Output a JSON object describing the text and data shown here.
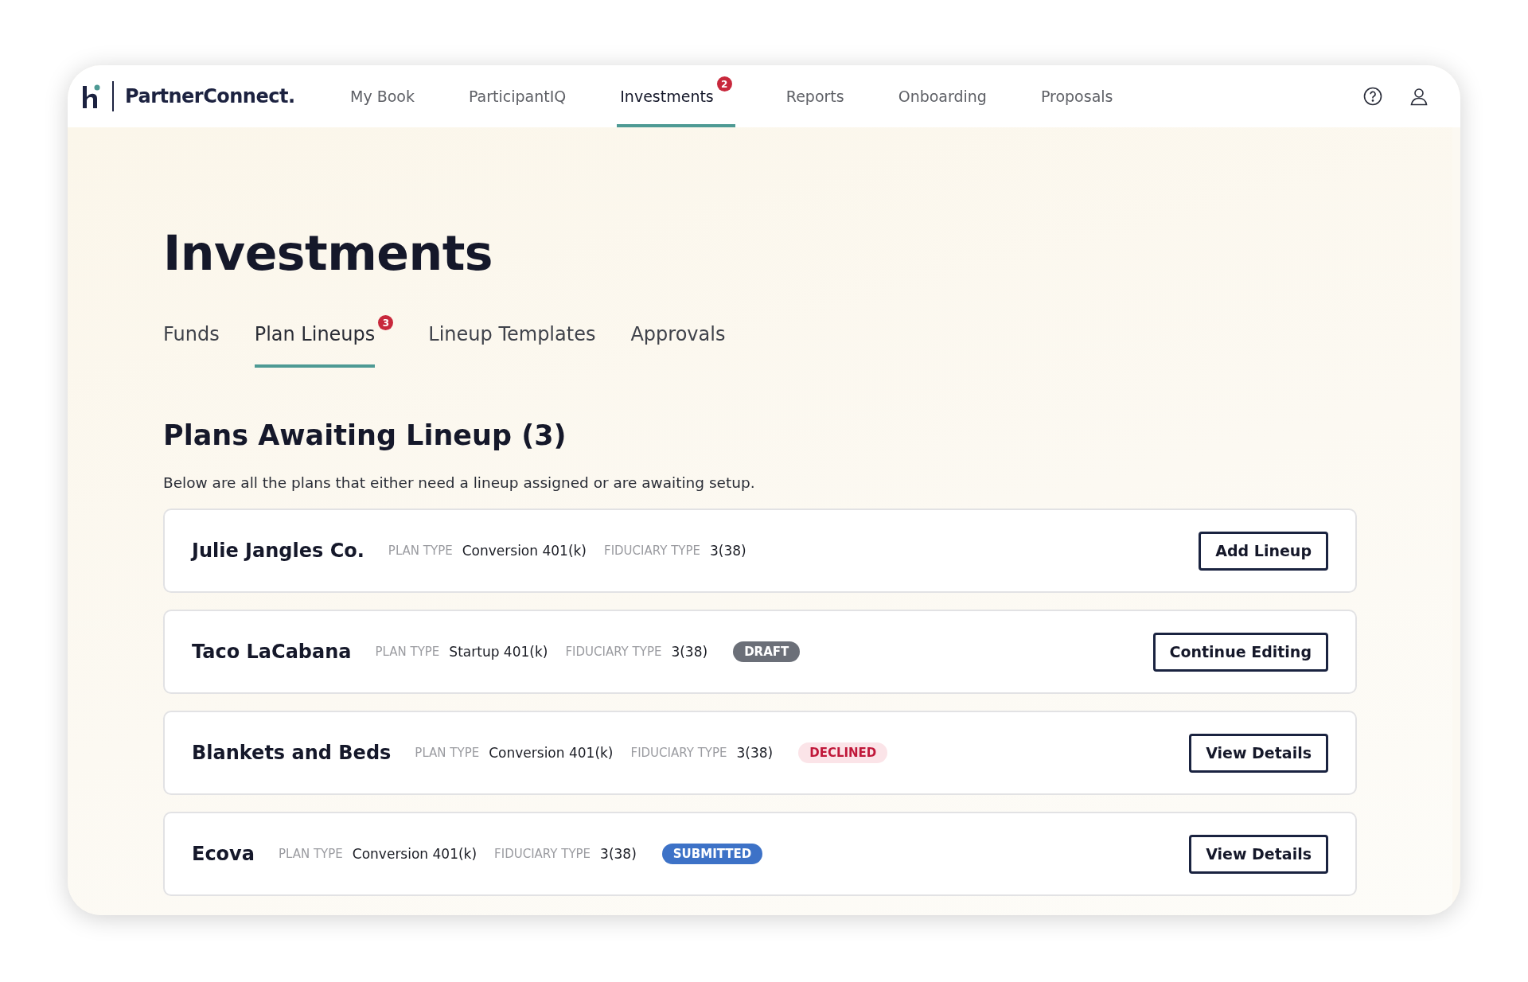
{
  "brand": {
    "name": "PartnerConnect."
  },
  "nav": [
    {
      "label": "My Book",
      "selected": false
    },
    {
      "label": "ParticipantIQ",
      "selected": false
    },
    {
      "label": "Investments",
      "selected": true,
      "badge": "2"
    },
    {
      "label": "Reports",
      "selected": false
    },
    {
      "label": "Onboarding",
      "selected": false
    },
    {
      "label": "Proposals",
      "selected": false
    }
  ],
  "page_title": "Investments",
  "tabs": [
    {
      "label": "Funds",
      "selected": false
    },
    {
      "label": "Plan Lineups",
      "selected": true,
      "badge": "3"
    },
    {
      "label": "Lineup Templates",
      "selected": false
    },
    {
      "label": "Approvals",
      "selected": false
    }
  ],
  "section": {
    "title": "Plans Awaiting Lineup (3)",
    "description": "Below are all the plans that either need a lineup assigned or are awaiting setup."
  },
  "plans": [
    {
      "name": "Julie Jangles Co.",
      "plan_type_label": "PLAN TYPE",
      "plan_type": "Conversion 401(k)",
      "fiduciary_type_label": "FIDUCIARY TYPE",
      "fiduciary_type": "3(38)",
      "action": "Add Lineup"
    },
    {
      "name": "Taco LaCabana",
      "plan_type_label": "PLAN TYPE",
      "plan_type": "Startup 401(k)",
      "fiduciary_type_label": "FIDUCIARY TYPE",
      "fiduciary_type": "3(38)",
      "status": {
        "label": "DRAFT",
        "kind": "draft"
      },
      "action": "Continue Editing"
    },
    {
      "name": "Blankets and Beds",
      "plan_type_label": "PLAN TYPE",
      "plan_type": "Conversion 401(k)",
      "fiduciary_type_label": "FIDUCIARY TYPE",
      "fiduciary_type": "3(38)",
      "status": {
        "label": "DECLINED",
        "kind": "declined"
      },
      "action": "View Details"
    },
    {
      "name": "Ecova",
      "plan_type_label": "PLAN TYPE",
      "plan_type": "Conversion 401(k)",
      "fiduciary_type_label": "FIDUCIARY TYPE",
      "fiduciary_type": "3(38)",
      "status": {
        "label": "SUBMITTED",
        "kind": "submitted"
      },
      "action": "View Details"
    }
  ]
}
